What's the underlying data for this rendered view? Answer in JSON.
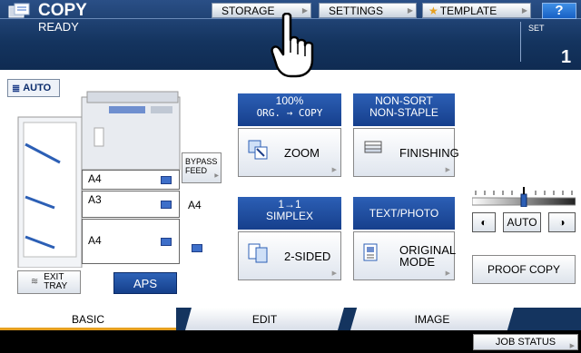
{
  "header": {
    "app_title": "COPY",
    "status": "READY",
    "buttons": {
      "storage": "STORAGE",
      "settings": "SETTINGS",
      "template": "TEMPLATE",
      "help": "?"
    },
    "set_label": "SET",
    "set_value": "1"
  },
  "machine": {
    "auto_label": "AUTO",
    "trays": [
      "A4",
      "A3",
      "A4"
    ],
    "bypass_label_1": "BYPASS",
    "bypass_label_2": "FEED",
    "bypass_size": "A4",
    "exit_label_1": "EXIT",
    "exit_label_2": "TRAY",
    "aps_label": "APS"
  },
  "functions": {
    "zoom_info_1": "100%",
    "zoom_info_2": "ORG. → COPY",
    "zoom_label": "ZOOM",
    "finishing_info_1": "NON-SORT",
    "finishing_info_2": "NON-STAPLE",
    "finishing_label": "FINISHING",
    "duplex_info_1": "1→1",
    "duplex_info_2": "SIMPLEX",
    "duplex_label": "2-SIDED",
    "mode_info": "TEXT/PHOTO",
    "mode_label_1": "ORIGINAL",
    "mode_label_2": "MODE"
  },
  "density": {
    "auto_label": "AUTO",
    "proof_copy": "PROOF COPY",
    "level": 0.5
  },
  "tabs": {
    "basic": "BASIC",
    "edit": "EDIT",
    "image": "IMAGE"
  },
  "footer": {
    "job_status": "JOB STATUS"
  },
  "colors": {
    "header_blue": "#14345f",
    "accent_blue": "#2c5fb5",
    "tab_accent": "#e6a020"
  }
}
